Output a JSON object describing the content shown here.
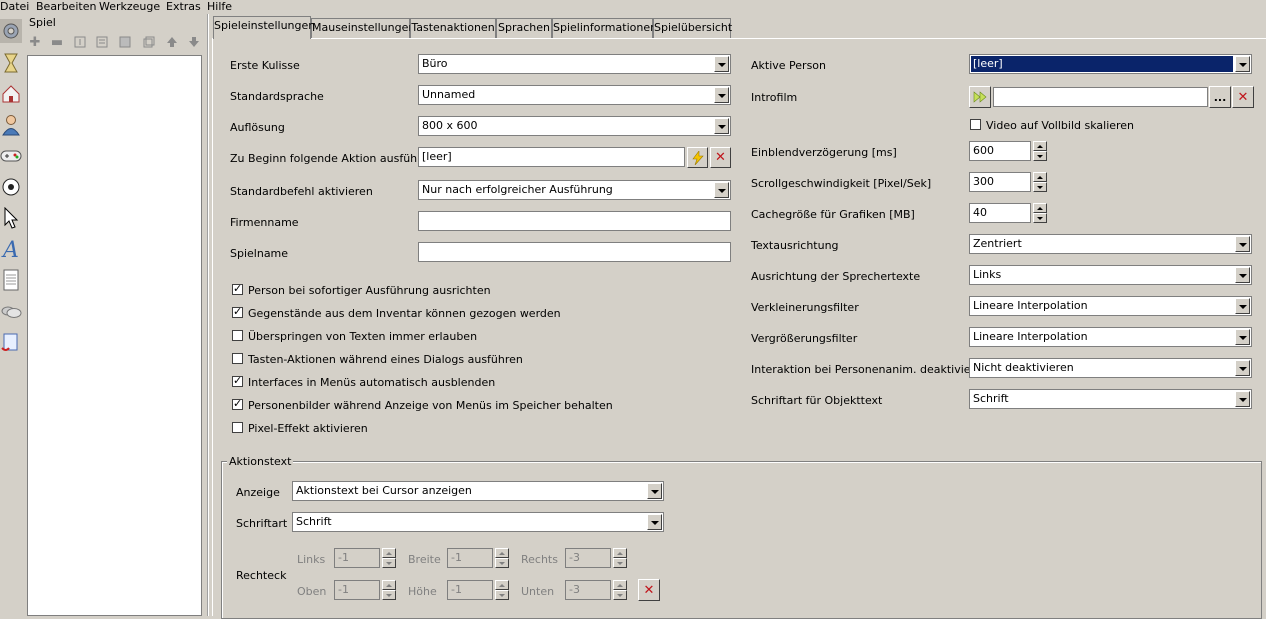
{
  "menu": [
    "Datei",
    "Bearbeiten",
    "Werkzeuge",
    "Extras",
    "Hilfe"
  ],
  "left_icons": [
    "settings-gear-icon",
    "hourglass-icon",
    "house-icon",
    "person-icon",
    "gamepad-icon",
    "ball-icon",
    "cursor-icon",
    "font-icon",
    "document-icon",
    "clouds-icon",
    "script-icon"
  ],
  "tree": {
    "title": "Spiel",
    "toolbar": [
      "add-icon",
      "remove-icon",
      "rename-icon",
      "properties-icon",
      "save-icon",
      "copy-icon",
      "move-up-icon",
      "move-down-icon"
    ]
  },
  "tabs": [
    "Spieleinstellungen",
    "Mauseinstellungen",
    "Tastenaktionen",
    "Sprachen",
    "Spielinformationen",
    "Spielübersicht"
  ],
  "left_form": {
    "erste_kulisse": {
      "label": "Erste Kulisse",
      "value": "Büro"
    },
    "standardsprache": {
      "label": "Standardsprache",
      "value": "Unnamed"
    },
    "aufloesung": {
      "label": "Auflösung",
      "value": "800 x 600"
    },
    "beginn_aktion": {
      "label": "Zu Beginn folgende Aktion ausführen",
      "value": "[leer]"
    },
    "standardbefehl": {
      "label": "Standardbefehl aktivieren",
      "value": "Nur nach erfolgreicher Ausführung"
    },
    "firmenname": {
      "label": "Firmenname",
      "value": ""
    },
    "spielname": {
      "label": "Spielname",
      "value": ""
    }
  },
  "checkboxes": [
    {
      "label": "Person bei sofortiger Ausführung ausrichten",
      "checked": true
    },
    {
      "label": "Gegenstände aus dem Inventar können gezogen werden",
      "checked": true
    },
    {
      "label": "Überspringen von Texten immer erlauben",
      "checked": false
    },
    {
      "label": "Tasten-Aktionen während eines Dialogs ausführen",
      "checked": false
    },
    {
      "label": "Interfaces in Menüs automatisch ausblenden",
      "checked": true
    },
    {
      "label": "Personenbilder während Anzeige von Menüs im Speicher behalten",
      "checked": true
    },
    {
      "label": "Pixel-Effekt aktivieren",
      "checked": false
    }
  ],
  "right_form": {
    "aktive_person": {
      "label": "Aktive Person",
      "value": "[leer]"
    },
    "introfilm": {
      "label": "Introfilm",
      "value": "",
      "browse": "..."
    },
    "video_vollbild": {
      "label": "Video auf Vollbild skalieren",
      "checked": false
    },
    "einblend": {
      "label": "Einblendverzögerung [ms]",
      "value": "600"
    },
    "scroll": {
      "label": "Scrollgeschwindigkeit [Pixel/Sek]",
      "value": "300"
    },
    "cache": {
      "label": "Cachegröße für Grafiken [MB]",
      "value": "40"
    },
    "textausrichtung": {
      "label": "Textausrichtung",
      "value": "Zentriert"
    },
    "sprechertexte": {
      "label": "Ausrichtung der Sprechertexte",
      "value": "Links"
    },
    "verkleinerung": {
      "label": "Verkleinerungsfilter",
      "value": "Lineare Interpolation"
    },
    "vergroesserung": {
      "label": "Vergrößerungsfilter",
      "value": "Lineare Interpolation"
    },
    "interaktion": {
      "label": "Interaktion bei Personenanim. deaktivieren",
      "value": "Nicht deaktivieren"
    },
    "schriftart_obj": {
      "label": "Schriftart für Objekttext",
      "value": "Schrift"
    }
  },
  "aktionstext": {
    "title": "Aktionstext",
    "anzeige": {
      "label": "Anzeige",
      "value": "Aktionstext bei Cursor anzeigen"
    },
    "schriftart": {
      "label": "Schriftart",
      "value": "Schrift"
    },
    "rechteck": {
      "label": "Rechteck",
      "links": {
        "label": "Links",
        "value": "-1"
      },
      "breite": {
        "label": "Breite",
        "value": "-1"
      },
      "rechts": {
        "label": "Rechts",
        "value": "-3"
      },
      "oben": {
        "label": "Oben",
        "value": "-1"
      },
      "hoehe": {
        "label": "Höhe",
        "value": "-1"
      },
      "unten": {
        "label": "Unten",
        "value": "-3"
      }
    }
  },
  "colors": {
    "face": "#d4d0c8",
    "selection": "#0a246a",
    "delete_red": "#c0151b"
  }
}
